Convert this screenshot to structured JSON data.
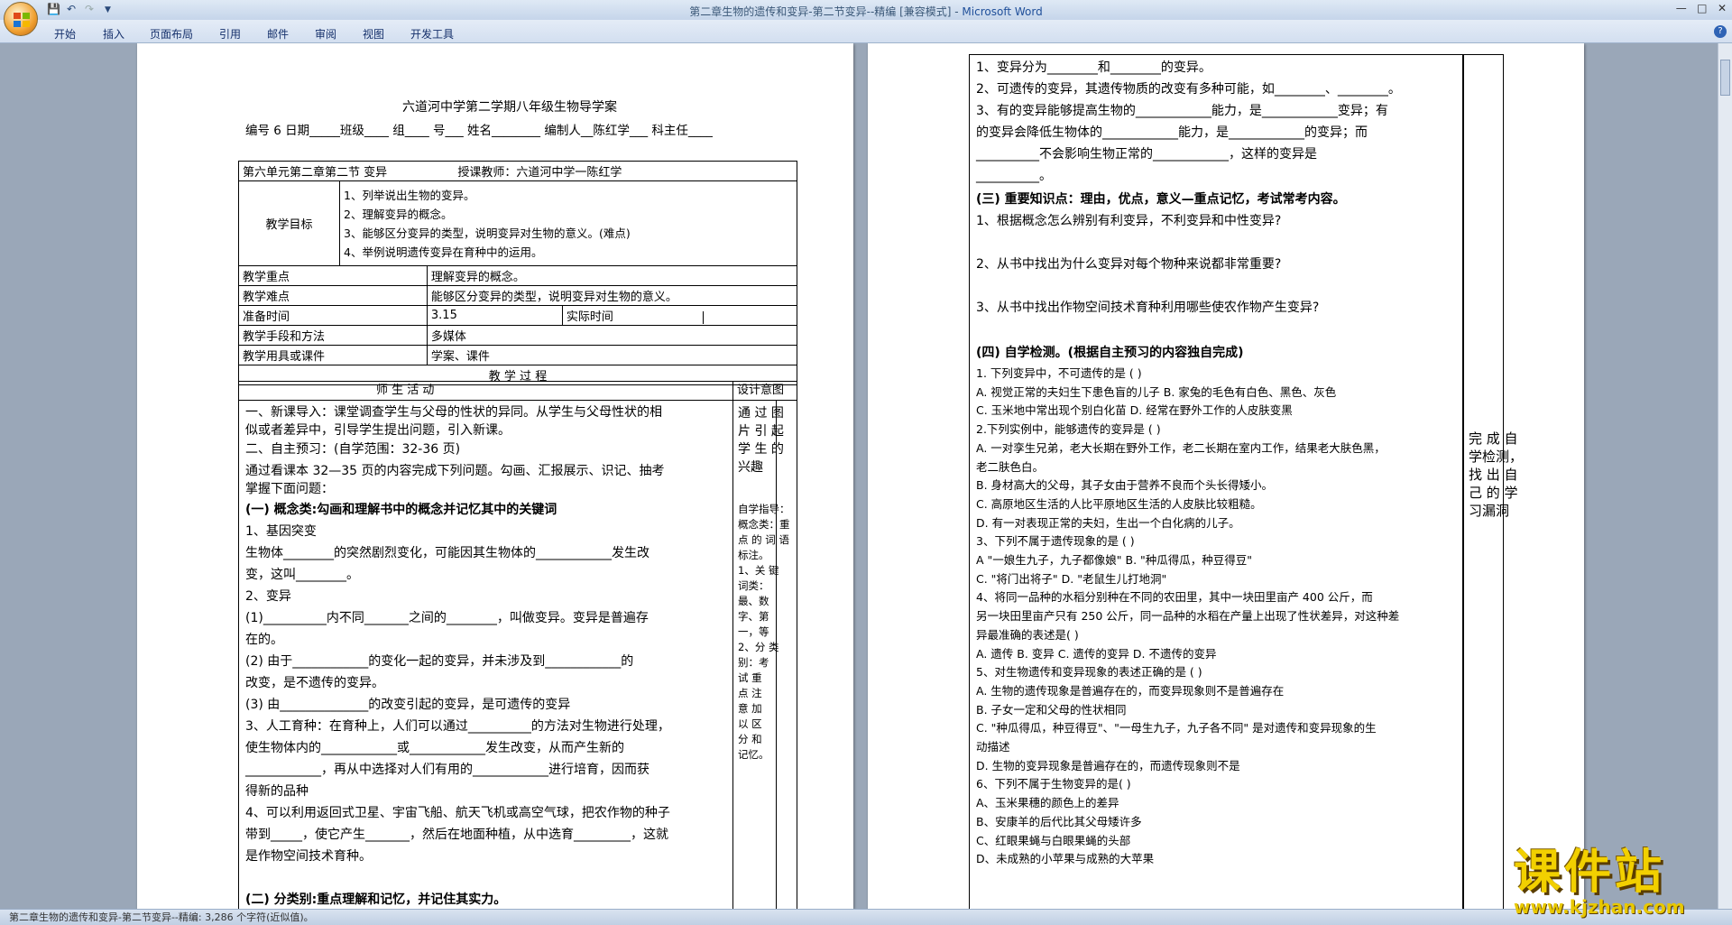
{
  "window": {
    "title_doc": "第二章生物的遗传和变异-第二节变异--精编 [兼容模式] - ",
    "title_app": "Microsoft Word"
  },
  "ribbon": {
    "tabs": [
      "开始",
      "插入",
      "页面布局",
      "引用",
      "邮件",
      "审阅",
      "视图",
      "开发工具"
    ]
  },
  "status": {
    "text": "第二章生物的遗传和变异-第二节变异--精编: 3,286 个字符(近似值)。"
  },
  "left": {
    "title": "六道河中学第二学期八年级生物导学案",
    "meta": "编号 6  日期_____班级____ 组____ 号___ 姓名________   编制人__陈红学___  科主任____",
    "header_unit": "第六单元第二章第二节      变异",
    "header_teacher": "授课教师：六道河中学一陈红学",
    "goals_label": "教学目标",
    "goals": [
      "1、列举说出生物的变异。",
      "2、理解变异的概念。",
      "3、能够区分变异的类型，说明变异对生物的意义。(难点)",
      "4、举例说明遗传变异在育种中的运用。"
    ],
    "rows": [
      {
        "k": "教学重点",
        "v": "理解变异的概念。"
      },
      {
        "k": "教学难点",
        "v": "能够区分变异的类型，说明变异对生物的意义。"
      },
      {
        "k": "准备时间",
        "v": "3.15",
        "k2": "实际时间"
      },
      {
        "k": "教学手段和方法",
        "v": "多媒体"
      },
      {
        "k": "教学用具或课件",
        "v": "学案、课件"
      }
    ],
    "process": "教          学          过          程",
    "activity": "师          生          活          动",
    "design": "设计意图",
    "body": [
      "一、新课导入：课堂调查学生与父母的性状的异同。从学生与父母性状的相",
      "似或者差异中，引导学生提出问题，引入新课。",
      "二、自主预习：(自学范围：32-36 页)",
      "   通过看课本 32—35 页的内容完成下列问题。勾画、汇报展示、识记、抽考",
      "掌握下面问题：",
      "    (一) 概念类:勾画和理解书中的概念并记忆其中的关键词",
      "1、基因突变",
      "生物体________的突然剧烈变化，可能因其生物体的____________发生改",
      "变，这叫________。",
      "2、变异",
      "(1)__________内不同_______之间的________，叫做变异。变异是普遍存",
      "在的。",
      "(2) 由于____________的变化一起的变异，并未涉及到____________的",
      "改变，是不遗传的变异。",
      "(3) 由______________的改变引起的变异，是可遗传的变异",
      "3、人工育种：在育种上，人们可以通过__________的方法对生物进行处理，",
      "使生物体内的____________或____________发生改变，从而产生新的",
      "____________，再从中选择对人们有用的____________进行培育，因而获",
      "得新的品种",
      "4、可以利用返回式卫星、宇宙飞船、航天飞机或高空气球，把农作物的种子",
      "带到_____，使它产生_______，然后在地面种植，从中选育_________，这就",
      "是作物空间技术育种。",
      "",
      "  (二) 分类别:重点理解和记忆，并记住其实力。"
    ],
    "side1": [
      "通 过 图",
      "片 引 起",
      "学 生 的",
      "兴趣"
    ],
    "side2": [
      "自学指导：",
      "概念类：重",
      "点 的 词 语",
      "标注。",
      "1、关  键",
      "  词类：",
      "  最、数",
      "  字、第",
      "  一，等",
      "2、分  类",
      "  别：考",
      "  试  重",
      "  点  注",
      "  意  加",
      "  以  区",
      "  分  和",
      "  记忆。"
    ]
  },
  "right": {
    "lines": [
      "1、变异分为________和________的变异。",
      "2、可遗传的变异，其遗传物质的改变有多种可能，如________、________。",
      "3、有的变异能够提高生物的____________能力，是____________变异；有",
      "的变异会降低生物体的____________能力，是____________的变异；而",
      "__________不会影响生物正常的____________，这样的变异是",
      "__________。",
      "(三) 重要知识点：理由，优点，意义—重点记忆，考试常考内容。",
      "1、根据概念怎么辨别有利变异，不利变异和中性变异?",
      "",
      "2、从书中找出为什么变异对每个物种来说都非常重要?",
      "",
      "3、从书中找出作物空间技术育种利用哪些使农作物产生变异?",
      "",
      "(四) 自学检测。(根据自主预习的内容独自完成)"
    ],
    "quiz": [
      "1. 下列变异中，不可遗传的是                                        (      )",
      "   A. 视觉正常的夫妇生下患色盲的儿子              B. 家兔的毛色有白色、黑色、灰色",
      "   C. 玉米地中常出现个别白化苗                       D. 经常在野外工作的人皮肤变黑",
      "2.下列实例中，能够遗传的变异是                                     (      )",
      "   A. 一对孪生兄弟，老大长期在野外工作，老二长期在室内工作，结果老大肤色黑，",
      "      老二肤色白。",
      "   B. 身材高大的父母，其子女由于营养不良而个头长得矮小。",
      "   C. 高原地区生活的人比平原地区生活的人皮肤比较粗糙。",
      "   D. 有一对表现正常的夫妇，生出一个白化病的儿子。",
      "3、下列不属于遗传现象的是                                          (       )",
      "   A \"一娘生九子，九子都像娘\"    B. \"种瓜得瓜，种豆得豆\"",
      "   C. \"将门出将子\"                         D. \"老鼠生儿打地洞\"",
      "4、将同一品种的水稻分别种在不同的农田里，其中一块田里亩产 400 公斤，而",
      "   另一块田里亩产只有 250 公斤，同一品种的水稻在产量上出现了性状差异，对这种差",
      "   异最准确的表述是(      )",
      "     A. 遗传         B. 变异          C. 遗传的变异        D. 不遗传的变异",
      "5、对生物遗传和变异现象的表述正确的是                               (      )",
      "   A. 生物的遗传现象是普遍存在的，而变异现象则不是普遍存在",
      "   B. 子女一定和父母的性状相同",
      "   C. \"种瓜得瓜，种豆得豆\"、\"一母生九子，九子各不同\" 是对遗传和变异现象的生",
      "      动描述",
      "   D. 生物的变异现象是普遍存在的，而遗传现象则不是",
      "6、下列不属于生物变异的是(        )",
      "   A、玉米果穗的颜色上的差异",
      "   B、安康羊的后代比其父母矮许多",
      "   C、红眼果蝇与白眼果蝇的头部",
      "   D、未成熟的小苹果与成熟的大苹果"
    ],
    "side": [
      "完 成 自",
      "学检测，",
      "找 出 自",
      "己 的 学",
      "习漏洞"
    ]
  },
  "watermark": {
    "cn": "课件站",
    "url": "www.kjzhan.com"
  }
}
